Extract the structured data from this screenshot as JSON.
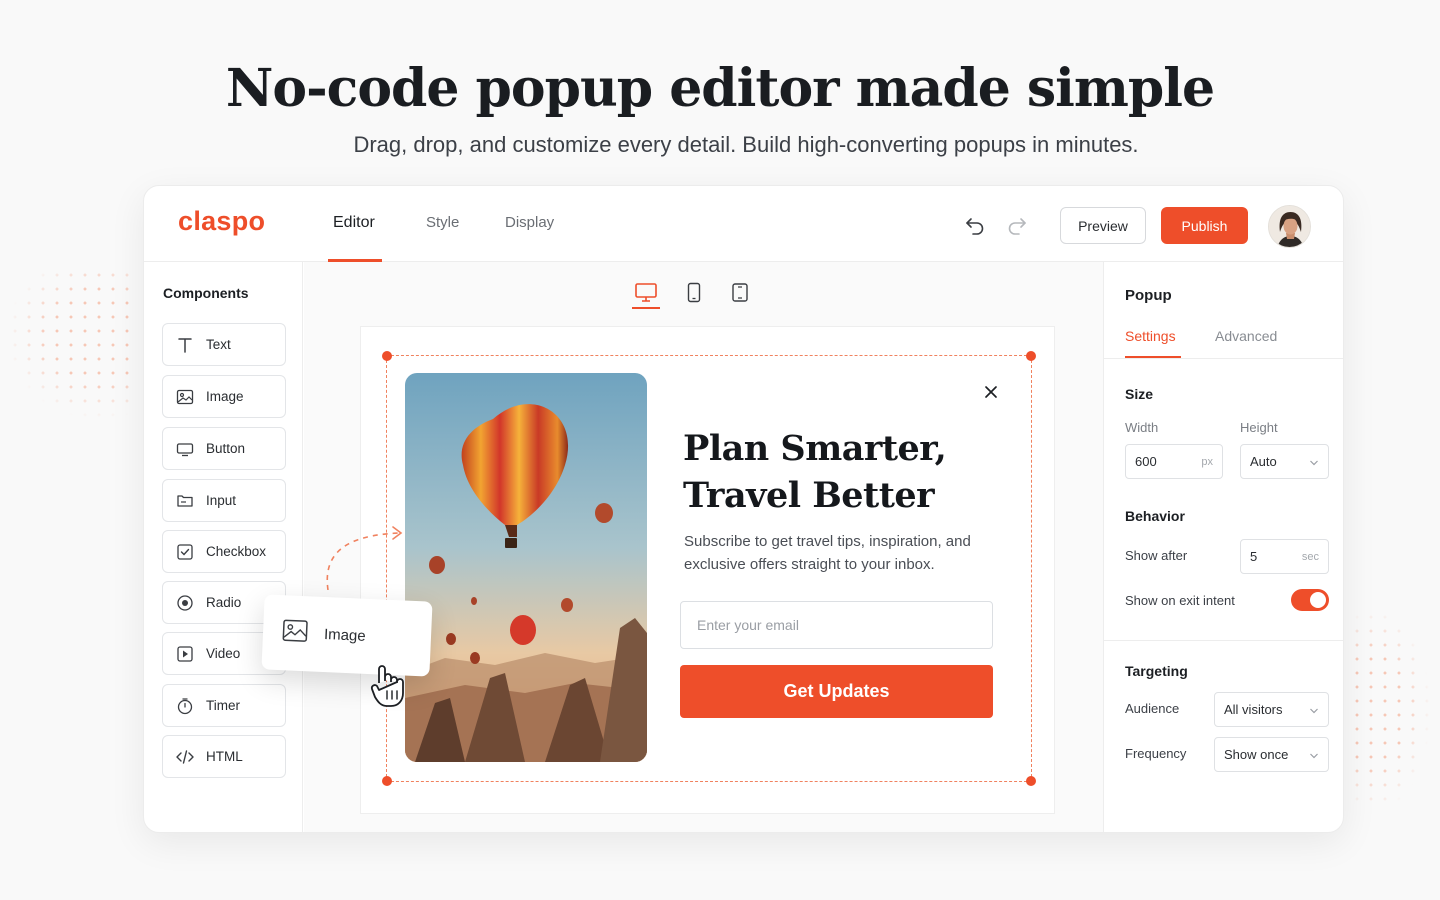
{
  "hero": {
    "title": "No-code popup editor made simple",
    "subtitle": "Drag, drop, and customize every detail. Build high-converting popups in minutes."
  },
  "app": {
    "logo": "claspo",
    "tabs": [
      {
        "label": "Editor",
        "active": true
      },
      {
        "label": "Style",
        "active": false
      },
      {
        "label": "Display",
        "active": false
      }
    ],
    "toolbar": {
      "undo_icon": "undo-icon",
      "redo_icon": "redo-icon",
      "preview_label": "Preview",
      "publish_label": "Publish"
    },
    "accent_color": "#ee4e2a"
  },
  "sidebar": {
    "title": "Components",
    "items": [
      {
        "label": "Text",
        "icon": "text-icon"
      },
      {
        "label": "Image",
        "icon": "image-icon"
      },
      {
        "label": "Button",
        "icon": "button-icon"
      },
      {
        "label": "Input",
        "icon": "input-icon"
      },
      {
        "label": "Checkbox",
        "icon": "checkbox-icon"
      },
      {
        "label": "Radio",
        "icon": "radio-icon"
      },
      {
        "label": "Video",
        "icon": "video-icon"
      },
      {
        "label": "Timer",
        "icon": "timer-icon"
      },
      {
        "label": "HTML",
        "icon": "code-icon"
      }
    ],
    "dragging": {
      "label": "Image",
      "icon": "image-icon"
    }
  },
  "canvas": {
    "devices": [
      "desktop-icon",
      "mobile-icon",
      "tablet-icon"
    ],
    "active_device": "desktop",
    "popup": {
      "title_line1": "Plan Smarter,",
      "title_line2": "Travel Better",
      "description": "Subscribe to get travel tips, inspiration, and exclusive offers straight to your inbox.",
      "email_placeholder": "Enter your email",
      "cta_label": "Get Updates"
    }
  },
  "panel": {
    "title": "Popup",
    "tabs": [
      {
        "label": "Settings",
        "active": true
      },
      {
        "label": "Advanced",
        "active": false
      }
    ],
    "size": {
      "title": "Size",
      "width_label": "Width",
      "width_value": "600",
      "width_unit": "px",
      "height_label": "Height",
      "height_value": "Auto"
    },
    "behavior": {
      "title": "Behavior",
      "show_after_label": "Show after",
      "show_after_value": "5",
      "show_after_unit": "sec",
      "exit_intent_label": "Show on exit intent",
      "exit_intent_enabled": true
    },
    "targeting": {
      "title": "Targeting",
      "audience_label": "Audience",
      "audience_value": "All visitors",
      "frequency_label": "Frequency",
      "frequency_value": "Show once"
    }
  }
}
